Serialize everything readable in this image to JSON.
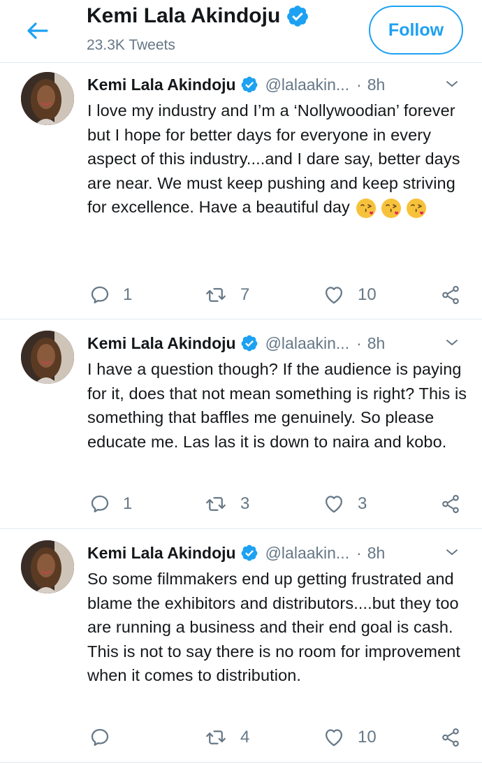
{
  "header": {
    "name": "Kemi Lala Akindoju",
    "tweet_count": "23.3K Tweets",
    "follow_label": "Follow"
  },
  "colors": {
    "accent": "#1da1f2",
    "secondary_text": "#657786",
    "divider": "#e1e8ed"
  },
  "tweets": [
    {
      "name": "Kemi Lala Akindoju",
      "handle": "@lalaakin...",
      "dot": "·",
      "time": "8h",
      "text": "I love my industry and I’m a ‘Nollywoodian’ forever but I hope for better days for everyone in every aspect of this industry....and I dare say, better days are near. We must keep pushing and keep striving for excellence. Have a beautiful day",
      "emojis": [
        "kissing-face-emoji",
        "kissing-face-emoji",
        "kissing-face-emoji"
      ],
      "replies": "1",
      "retweets": "7",
      "likes": "10"
    },
    {
      "name": "Kemi Lala Akindoju",
      "handle": "@lalaakin...",
      "dot": "·",
      "time": "8h",
      "text": "I have a question though? If the audience is paying for it, does that not mean something is right? This is something that baffles me genuinely. So please educate me. Las las it is down to naira and kobo.",
      "replies": "1",
      "retweets": "3",
      "likes": "3"
    },
    {
      "name": "Kemi Lala Akindoju",
      "handle": "@lalaakin...",
      "dot": "·",
      "time": "8h",
      "text": "So some filmmakers end up getting frustrated and blame the exhibitors and distributors....but they too are running a business and their end goal is cash. This is not to say there is no room for improvement when it comes to distribution.",
      "replies": "",
      "retweets": "4",
      "likes": "10"
    }
  ]
}
